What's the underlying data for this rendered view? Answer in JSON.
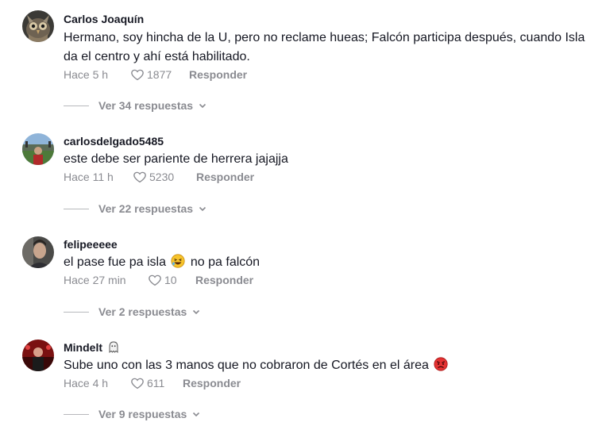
{
  "comments": [
    {
      "username": "Carlos Joaquín",
      "text": "Hermano, soy hincha de la U, pero no reclame hueas; Falcón participa después, cuando Isla da el centro y ahí está habilitado.",
      "time": "Hace 5 h",
      "likes": "1877",
      "reply": "Responder",
      "replies": "Ver 34 respuestas"
    },
    {
      "username": "carlosdelgado5485",
      "text": "este debe ser pariente de herrera jajajja",
      "time": "Hace 11 h",
      "likes": "5230",
      "reply": "Responder",
      "replies": "Ver 22 respuestas"
    },
    {
      "username": "felipeeeee",
      "text_before": "el pase fue pa isla",
      "text_after": "no pa falcón",
      "emoji": "laughing-emoji",
      "time": "Hace 27 min",
      "likes": "10",
      "reply": "Responder",
      "replies": "Ver 2 respuestas"
    },
    {
      "username": "Mindelt",
      "badge": "ghost-icon",
      "text": "Sube uno con las 3 manos que no cobraron de Cortés en el área",
      "emoji": "angry-face-emoji",
      "time": "Hace 4 h",
      "likes": "611",
      "reply": "Responder",
      "replies": "Ver 9 respuestas"
    }
  ],
  "colors": {
    "text": "#161823",
    "muted": "#8a8b91",
    "divider": "#b7b8bc",
    "background": "#ffffff"
  }
}
